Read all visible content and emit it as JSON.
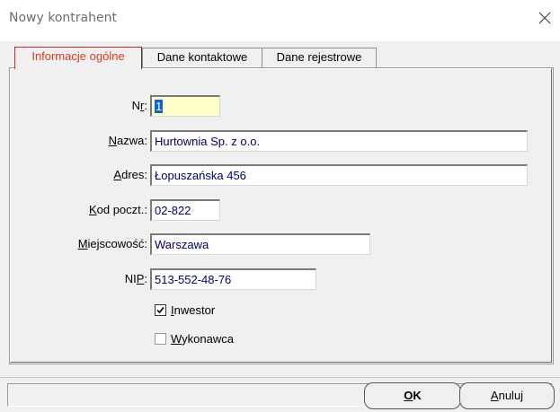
{
  "window": {
    "title": "Nowy kontrahent",
    "close_glyph": "×"
  },
  "tabs": [
    {
      "label": "Informacje ogólne",
      "active": true
    },
    {
      "label": "Dane kontaktowe",
      "active": false
    },
    {
      "label": "Dane rejestrowe",
      "active": false
    }
  ],
  "form": {
    "nr": {
      "label_pre": "N",
      "label_ul": "r",
      "label_post": ":",
      "value": "1"
    },
    "nazwa": {
      "label_pre": "",
      "label_ul": "N",
      "label_post": "azwa:",
      "value": "Hurtownia Sp. z o.o."
    },
    "adres": {
      "label_pre": "",
      "label_ul": "A",
      "label_post": "dres:",
      "value": "Łopuszańska 456"
    },
    "kod": {
      "label_pre": "",
      "label_ul": "K",
      "label_post": "od poczt.:",
      "value": "02-822"
    },
    "miejscowosc": {
      "label_pre": "",
      "label_ul": "M",
      "label_post": "iejscowość:",
      "value": "Warszawa"
    },
    "nip": {
      "label_pre": "NI",
      "label_ul": "P",
      "label_post": ":",
      "value": "513-552-48-76"
    }
  },
  "checkboxes": {
    "inwestor": {
      "label_pre": "",
      "label_ul": "I",
      "label_post": "nwestor",
      "checked": true
    },
    "wykonawca": {
      "label_pre": "",
      "label_ul": "W",
      "label_post": "ykonawca",
      "checked": false
    }
  },
  "buttons": {
    "ok": {
      "label_ul": "O",
      "label_post": "K"
    },
    "cancel": {
      "label_ul": "A",
      "label_post": "nuluj"
    }
  },
  "colors": {
    "active_tab_text": "#d93a1f",
    "field_text": "#00006b",
    "highlight_field": "#ffffcc",
    "selection": "#0a64d6"
  },
  "icons": {
    "close": "close-icon",
    "checkmark": "checkmark-icon"
  }
}
